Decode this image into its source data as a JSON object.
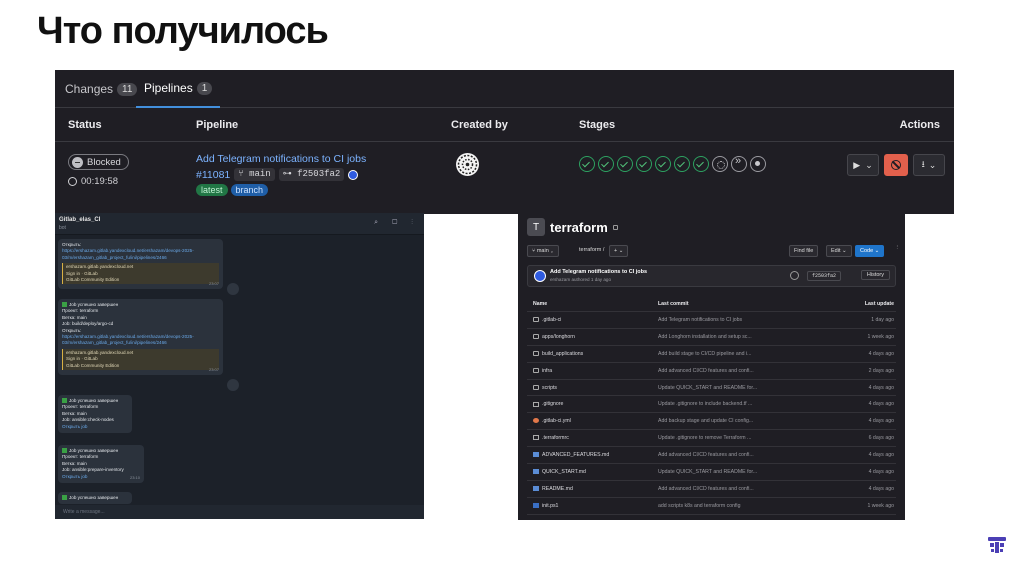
{
  "slide": {
    "title": "Что получилось"
  },
  "pipeline": {
    "tabs": [
      {
        "label": "Changes",
        "count": "11"
      },
      {
        "label": "Pipelines",
        "count": "1"
      }
    ],
    "columns": {
      "status": "Status",
      "pipeline": "Pipeline",
      "created_by": "Created by",
      "stages": "Stages",
      "actions": "Actions"
    },
    "row": {
      "status": "Blocked",
      "duration": "00:19:58",
      "title": "Add Telegram notifications to CI jobs",
      "id": "#11081",
      "branch": "main",
      "sha": "f2503fa2",
      "labels": [
        "latest",
        "branch"
      ]
    },
    "stages": [
      "success",
      "success",
      "success",
      "success",
      "success",
      "success",
      "success",
      "manual",
      "skipped",
      "created"
    ],
    "accent_colors": {
      "success": "#2da160",
      "cancel": "#e2604c",
      "link": "#7cb3ff"
    }
  },
  "telegram": {
    "chat_name": "Gitlab_elas_CI",
    "chat_sub": "bot",
    "messages": [
      {
        "lines": [
          "Открыть:",
          "https://ershazam.gitlab.yandexcloud.net/ershazam/devops-2025-03/m/ershazam_gitlab_project_fu/ini/pipelines/2466"
        ],
        "quote": [
          "ershazam.gitlab.yandexcloud.net",
          "Sign in · GitLab",
          "GitLab Community Edition"
        ],
        "time": "23:07"
      },
      {
        "lines": [
          "Job успешно завершен",
          "",
          "Проект: terraform",
          "Ветка: main",
          "Job: build/deploy/argo-cd",
          "Открыть:",
          "https://ershazam.gitlab.yandexcloud.net/ershazam/devops-2025-03/m/ershazam_gitlab_project_fu/ini/pipelines/2466"
        ],
        "quote": [
          "ershazam.gitlab.yandexcloud.net",
          "Sign in · GitLab",
          "GitLab Community Edition"
        ],
        "time": "23:07"
      },
      {
        "lines": [
          "Job успешно завершен",
          "Проект: terraform",
          "Ветка: main",
          "Job: ansible:check-nodes",
          "Открыть job"
        ],
        "time": "23:09"
      },
      {
        "lines": [
          "Job успешно завершен",
          "Проект: terraform",
          "Ветка: main",
          "Job: ansible:prepare-inventory",
          "Открыть job"
        ],
        "time": "23:10"
      },
      {
        "lines": [
          "Job успешно завершен"
        ],
        "time": ""
      }
    ],
    "input_placeholder": "Write a message..."
  },
  "repo": {
    "name": "terraform",
    "branch": "main",
    "crumb": "terraform  /",
    "add_label": "+",
    "find_file": "Find file",
    "edit": "Edit",
    "code": "Code",
    "commit_message": "Add Telegram notifications to CI jobs",
    "commit_author": "ershazam authored 1 day ago",
    "commit_sha": "f2503fa2",
    "history": "History",
    "columns": {
      "name": "Name",
      "last_commit": "Last commit",
      "last_update": "Last update"
    },
    "files": [
      {
        "icon": "dir",
        "name": ".gitlab-ci",
        "commit": "Add Telegram notifications to CI jobs",
        "updated": "1 day ago"
      },
      {
        "icon": "dir",
        "name": "apps/longhorn",
        "commit": "Add Longhorn installation and setup sc...",
        "updated": "1 week ago"
      },
      {
        "icon": "dir",
        "name": "build_applications",
        "commit": "Add build stage to CI/CD pipeline and i...",
        "updated": "4 days ago"
      },
      {
        "icon": "dir",
        "name": "infra",
        "commit": "Add advanced CI/CD features and confi...",
        "updated": "2 days ago"
      },
      {
        "icon": "dir",
        "name": "scripts",
        "commit": "Update QUICK_START and README for...",
        "updated": "4 days ago"
      },
      {
        "icon": "file",
        "name": ".gitignore",
        "commit": "Update .gitignore to include backend.tf ...",
        "updated": "4 days ago"
      },
      {
        "icon": "yml",
        "name": ".gitlab-ci.yml",
        "commit": "Add backup stage and update CI config...",
        "updated": "4 days ago"
      },
      {
        "icon": "file",
        "name": ".terraformrc",
        "commit": "Update .gitignore to remove Terraform ...",
        "updated": "6 days ago"
      },
      {
        "icon": "md",
        "name": "ADVANCED_FEATURES.md",
        "commit": "Add advanced CI/CD features and confi...",
        "updated": "4 days ago"
      },
      {
        "icon": "md",
        "name": "QUICK_START.md",
        "commit": "Update QUICK_START and README for...",
        "updated": "4 days ago"
      },
      {
        "icon": "md",
        "name": "README.md",
        "commit": "Add advanced CI/CD features and confi...",
        "updated": "4 days ago"
      },
      {
        "icon": "ps",
        "name": "init.ps1",
        "commit": "add scripts k8s and terraform config",
        "updated": "1 week ago"
      }
    ]
  }
}
